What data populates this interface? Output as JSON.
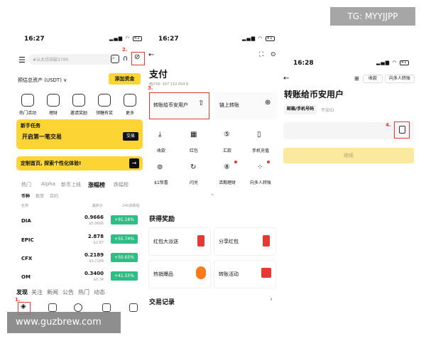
{
  "screens": {
    "s1": {
      "time": "16:27",
      "battery": "42",
      "search_placeholder": "#以太坊突破3700",
      "estimated_assets": "预估总资产 (USDT) ∨",
      "add_funds": "添加资金",
      "quick_actions": [
        "热门活动",
        "理财",
        "邀请奖励",
        "领糖有奖",
        "更多"
      ],
      "newbie_title": "新手任务",
      "newbie_task": "开启第一笔交易",
      "newbie_button": "交易",
      "customize_banner": "定制首页, 探索个性化体验!",
      "market_tabs": [
        "热门",
        "Alpha",
        "新币上线",
        "涨幅榜",
        "跌幅榜"
      ],
      "sub_tabs": [
        "币种",
        "现货",
        "合约"
      ],
      "col_name": "名称",
      "col_price": "最新价",
      "col_change": "24h涨跌幅",
      "coins": [
        {
          "name": "DIA",
          "price": "0.9666",
          "sub": "$0.9666",
          "change": "+91.18%"
        },
        {
          "name": "EPIC",
          "price": "2.878",
          "sub": "$2.87",
          "change": "+55.74%"
        },
        {
          "name": "CFX",
          "price": "0.2189",
          "sub": "$0.2189",
          "change": "+50.65%"
        },
        {
          "name": "OM",
          "price": "0.3400",
          "sub": "$0.34",
          "change": "+41.55%"
        }
      ],
      "feed_tabs": [
        "发现",
        "关注",
        "新闻",
        "公告",
        "热门",
        "动态"
      ],
      "step1": "1.",
      "step2": "2."
    },
    "s2": {
      "time": "16:27",
      "battery": "41",
      "title": "支付",
      "uid": "用户ID: 107 110 054 8",
      "step3": "3.",
      "card1": "转账给币安用户",
      "card2": "链上转账",
      "grid": [
        "收款",
        "红包",
        "汇款",
        "手机充值",
        "$1惊喜",
        "闪兑",
        "活期理财",
        "向多人转账"
      ],
      "rewards_title": "获得奖励",
      "tiles": [
        "红包大派送",
        "分享红包",
        "热销爆品",
        "转账活动"
      ],
      "records": "交易记录"
    },
    "s3": {
      "time": "16:28",
      "battery": "41",
      "btn_receive": "收款",
      "btn_multi": "向多人转账",
      "title": "转账给币安用户",
      "tab_active": "邮箱/手机号码",
      "tab_inactive": "币安ID",
      "step4": "4.",
      "continue": "继续"
    }
  },
  "watermark_top": "TG: MYYJJPP",
  "watermark_bottom": "www.guzbrew.com",
  "colors": {
    "brand_yellow": "#fcd535",
    "green": "#2ebd85",
    "red": "#e53935"
  }
}
